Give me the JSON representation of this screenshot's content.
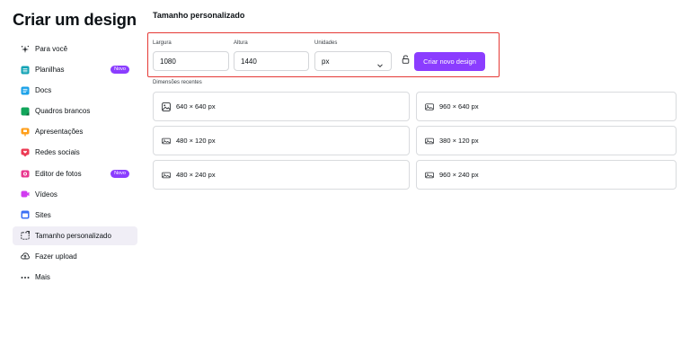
{
  "sidebar": {
    "title": "Criar um design",
    "items": [
      {
        "label": "Para você",
        "icon": "sparkle-icon",
        "badge": "",
        "active": false
      },
      {
        "label": "Planilhas",
        "icon": "spreadsheet-icon",
        "badge": "Novo",
        "active": false
      },
      {
        "label": "Docs",
        "icon": "docs-icon",
        "badge": "",
        "active": false
      },
      {
        "label": "Quadros brancos",
        "icon": "whiteboard-icon",
        "badge": "",
        "active": false
      },
      {
        "label": "Apresentações",
        "icon": "presentation-icon",
        "badge": "",
        "active": false
      },
      {
        "label": "Redes sociais",
        "icon": "social-media-icon",
        "badge": "",
        "active": false
      },
      {
        "label": "Editor de fotos",
        "icon": "photo-editor-icon",
        "badge": "Novo",
        "active": false
      },
      {
        "label": "Vídeos",
        "icon": "video-icon",
        "badge": "",
        "active": false
      },
      {
        "label": "Sites",
        "icon": "website-icon",
        "badge": "",
        "active": false
      },
      {
        "label": "Tamanho personalizado",
        "icon": "custom-size-icon",
        "badge": "",
        "active": true
      },
      {
        "label": "Fazer upload",
        "icon": "upload-icon",
        "badge": "",
        "active": false
      },
      {
        "label": "Mais",
        "icon": "more-icon",
        "badge": "",
        "active": false
      }
    ]
  },
  "custom_size": {
    "title": "Tamanho personalizado",
    "width_label": "Largura",
    "width_value": "1080",
    "height_label": "Altura",
    "height_value": "1440",
    "units_label": "Unidades",
    "units_value": "px",
    "create_button": "Criar novo design"
  },
  "recent": {
    "heading": "Dimensões recentes",
    "items": [
      {
        "label": "640 × 640 px",
        "icon": "image-icon"
      },
      {
        "label": "960 × 640 px",
        "icon": "image-icon"
      },
      {
        "label": "480 × 120 px",
        "icon": "image-icon"
      },
      {
        "label": "380 × 120 px",
        "icon": "image-icon"
      },
      {
        "label": "480 × 240 px",
        "icon": "image-icon"
      },
      {
        "label": "960 × 240 px",
        "icon": "image-icon"
      }
    ]
  },
  "colors": {
    "accent": "#8b3dff",
    "highlight_border": "#e53935",
    "active_nav_bg": "#f0eef6"
  }
}
